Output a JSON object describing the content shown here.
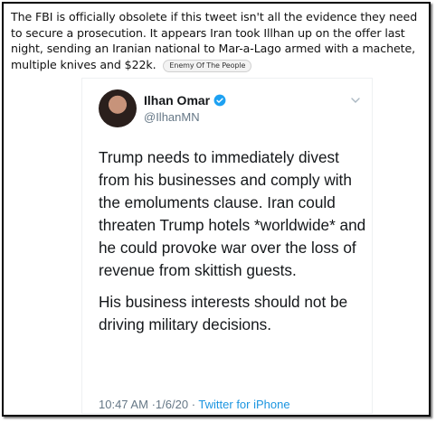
{
  "caption": {
    "text": "The FBI is officially obsolete if this tweet isn't all the evidence they need to secure a prosecution. It appears Iran took Illhan up on the offer last night, sending an Iranian national to Mar-a-Lago armed with a machete, multiple knives and $22k.",
    "badge": "Enemy Of The People"
  },
  "tweet": {
    "author_name": "Ilhan Omar",
    "handle": "@IlhanMN",
    "paragraph_1": "Trump needs to immediately divest from his businesses and comply with the emoluments clause. Iran could threaten Trump hotels *worldwide* and he could provoke war over the loss of revenue from skittish guests.",
    "paragraph_2": "His business interests should not be driving military decisions.",
    "time": "10:47 AM",
    "date": "1/6/20",
    "separator": "·",
    "source": "Twitter for iPhone"
  },
  "colors": {
    "verified": "#1da1f2",
    "link": "#1b95e0",
    "muted": "#657786"
  },
  "icons": {
    "verified": "verified-badge-icon",
    "caret": "chevron-down-icon"
  }
}
